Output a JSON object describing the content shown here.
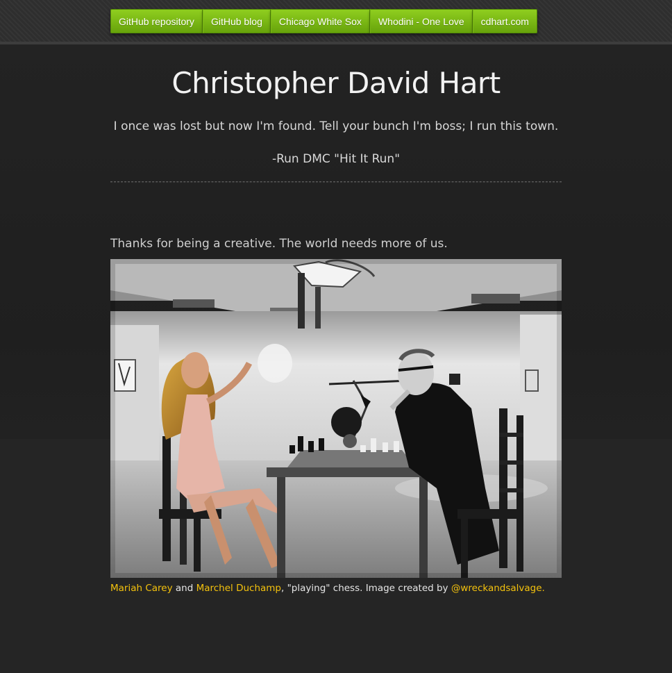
{
  "nav": {
    "items": [
      {
        "label": "GitHub repository"
      },
      {
        "label": "GitHub blog"
      },
      {
        "label": "Chicago White Sox"
      },
      {
        "label": "Whodini - One Love"
      },
      {
        "label": "cdhart.com"
      }
    ]
  },
  "header": {
    "title": "Christopher David Hart",
    "quote": "I once was lost but now I'm found. Tell your bunch I'm boss; I run this town.",
    "cite": "-Run DMC \"Hit It Run\""
  },
  "main": {
    "intro": "Thanks for being a creative. The world needs more of us.",
    "caption": {
      "link1": "Mariah Carey",
      "and": " and ",
      "link2": "Marchel Duchamp",
      "middle": ", \"playing\" chess. Image created by ",
      "link3": "@wreckandsalvage."
    }
  },
  "colors": {
    "nav_green": "#7cbb16",
    "link_yellow": "#f4c20d",
    "background": "#252525"
  }
}
